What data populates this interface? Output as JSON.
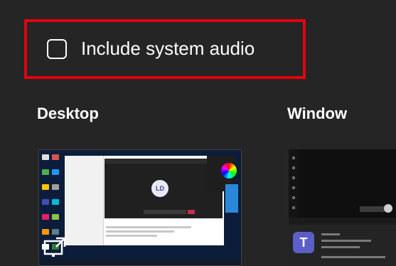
{
  "audio": {
    "checked": false,
    "label": "Include system audio"
  },
  "sections": {
    "desktop": {
      "title": "Desktop",
      "avatar_initials": "LD"
    },
    "window": {
      "title": "Window"
    }
  },
  "colors": {
    "highlight": "#e3000f",
    "background": "#252525",
    "teams": "#5b5fc7"
  },
  "icons": [
    "screen-share-icon",
    "teams-icon"
  ]
}
